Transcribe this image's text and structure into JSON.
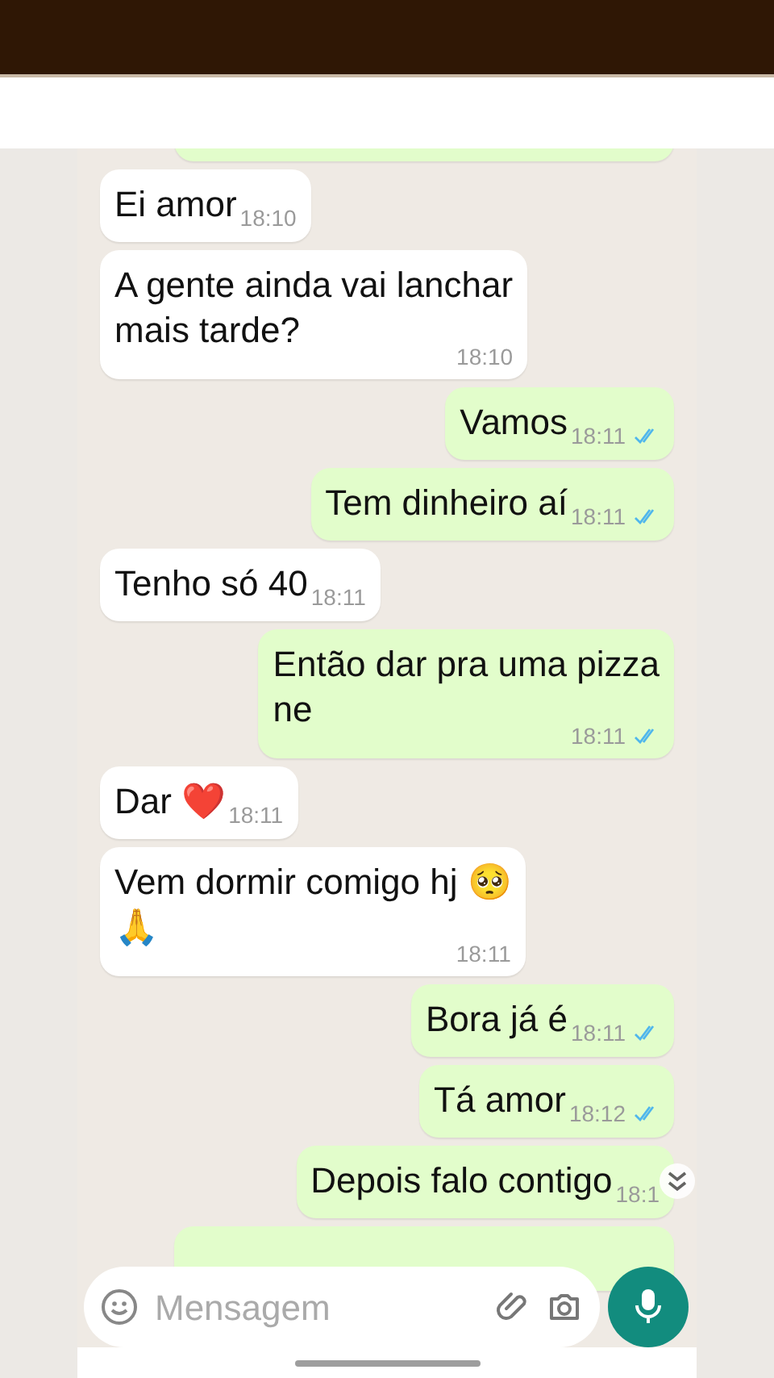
{
  "messages": [
    {
      "kind": "out"
    },
    {
      "kind": "in",
      "text": "Ei amor",
      "time": "18:10"
    },
    {
      "kind": "in",
      "text": "A gente ainda vai lanchar\nmais tarde?",
      "time": "18:10"
    },
    {
      "kind": "out",
      "text": "Vamos",
      "time": "18:11",
      "read": true
    },
    {
      "kind": "out",
      "text": "Tem dinheiro aí",
      "time": "18:11",
      "read": true
    },
    {
      "kind": "in",
      "text": "Tenho só 40",
      "time": "18:11"
    },
    {
      "kind": "out",
      "text": "Então dar pra uma pizza\nne",
      "time": "18:11",
      "read": true
    },
    {
      "kind": "in",
      "text": "Dar ❤️",
      "time": "18:11"
    },
    {
      "kind": "in",
      "text": "Vem dormir comigo hj 🥺\n🙏",
      "time": "18:11"
    },
    {
      "kind": "out",
      "text": "Bora já é",
      "time": "18:11",
      "read": true
    },
    {
      "kind": "out",
      "text": "Tá amor",
      "time": "18:12",
      "read": true
    },
    {
      "kind": "out",
      "text": "Depois falo contigo",
      "time": "18:1"
    },
    {
      "kind": "out"
    }
  ],
  "composer": {
    "placeholder": "Mensagem"
  }
}
